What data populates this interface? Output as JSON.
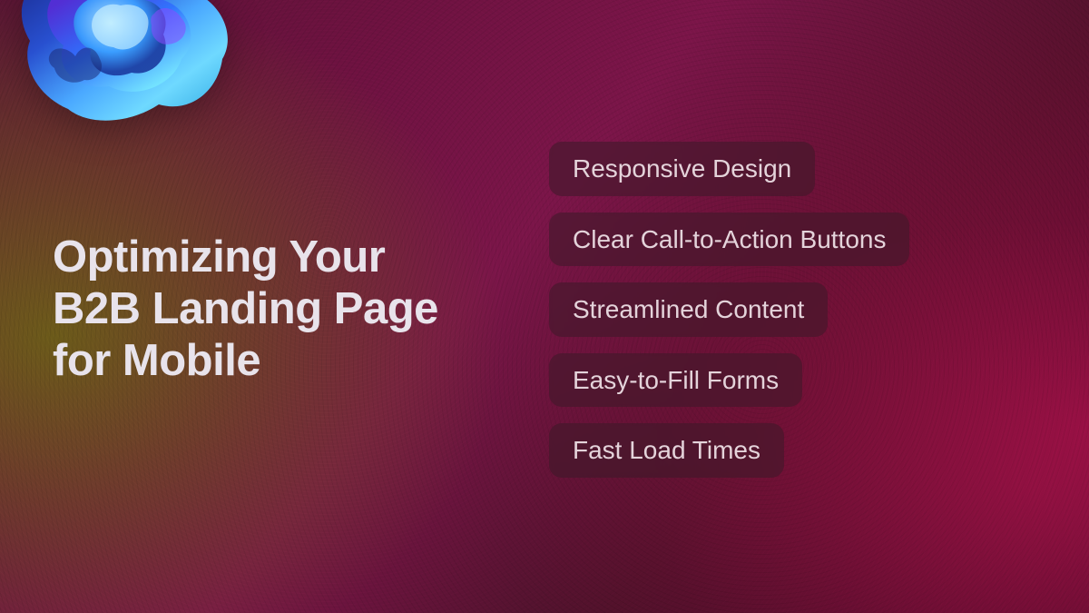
{
  "title": "Optimizing Your\nB2B Landing Page\nfor Mobile",
  "pills": [
    "Responsive Design",
    "Clear Call-to-Action Buttons",
    "Streamlined Content",
    "Easy-to-Fill Forms",
    "Fast Load Times"
  ]
}
